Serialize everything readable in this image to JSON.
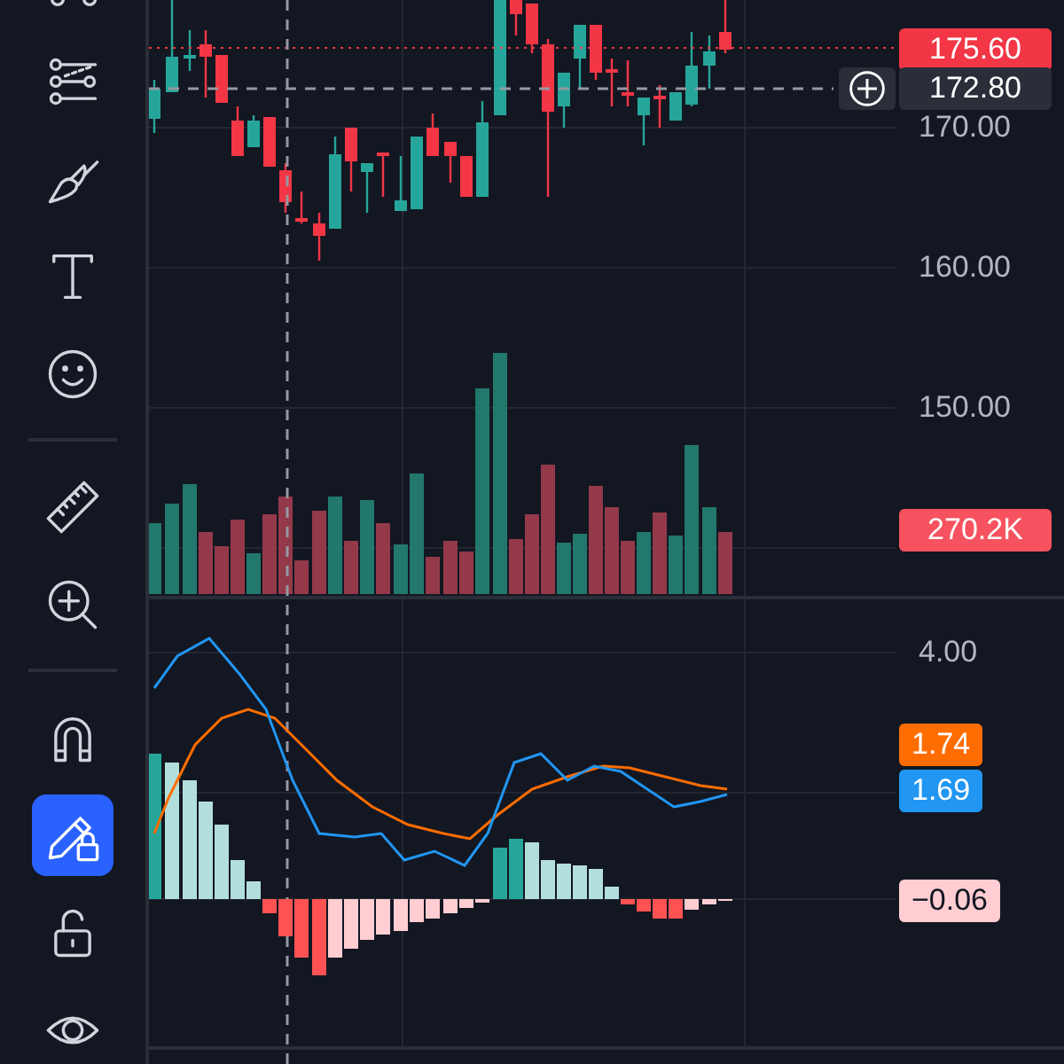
{
  "toolbar": {
    "groups": [
      {
        "tools": [
          {
            "selected": false
          },
          {
            "selected": false
          },
          {
            "selected": false
          },
          {
            "selected": false
          },
          {
            "selected": false
          }
        ]
      },
      {
        "tools": [
          {
            "selected": false
          },
          {
            "selected": false
          }
        ]
      },
      {
        "tools": [
          {
            "selected": false
          },
          {
            "selected": true
          },
          {
            "selected": false
          },
          {
            "selected": false
          }
        ]
      }
    ]
  },
  "price_axis": {
    "ticks": [
      "170.00",
      "160.00",
      "150.00"
    ]
  },
  "price_tags": [
    {
      "kind": "last",
      "text": "175.60",
      "color": "#f23645"
    },
    {
      "kind": "crosshair",
      "text": "172.80",
      "color": "#2a2e39"
    }
  ],
  "volume_tag": {
    "text": "270.2K",
    "color": "#f7525f"
  },
  "macd_axis": {
    "ticks": [
      "4.00"
    ]
  },
  "macd_tags": [
    {
      "text": "1.74",
      "color": "#ff6d00"
    },
    {
      "text": "1.69",
      "color": "#2196f3"
    },
    {
      "text": "−0.06",
      "color": "#ffcdd2"
    }
  ]
}
